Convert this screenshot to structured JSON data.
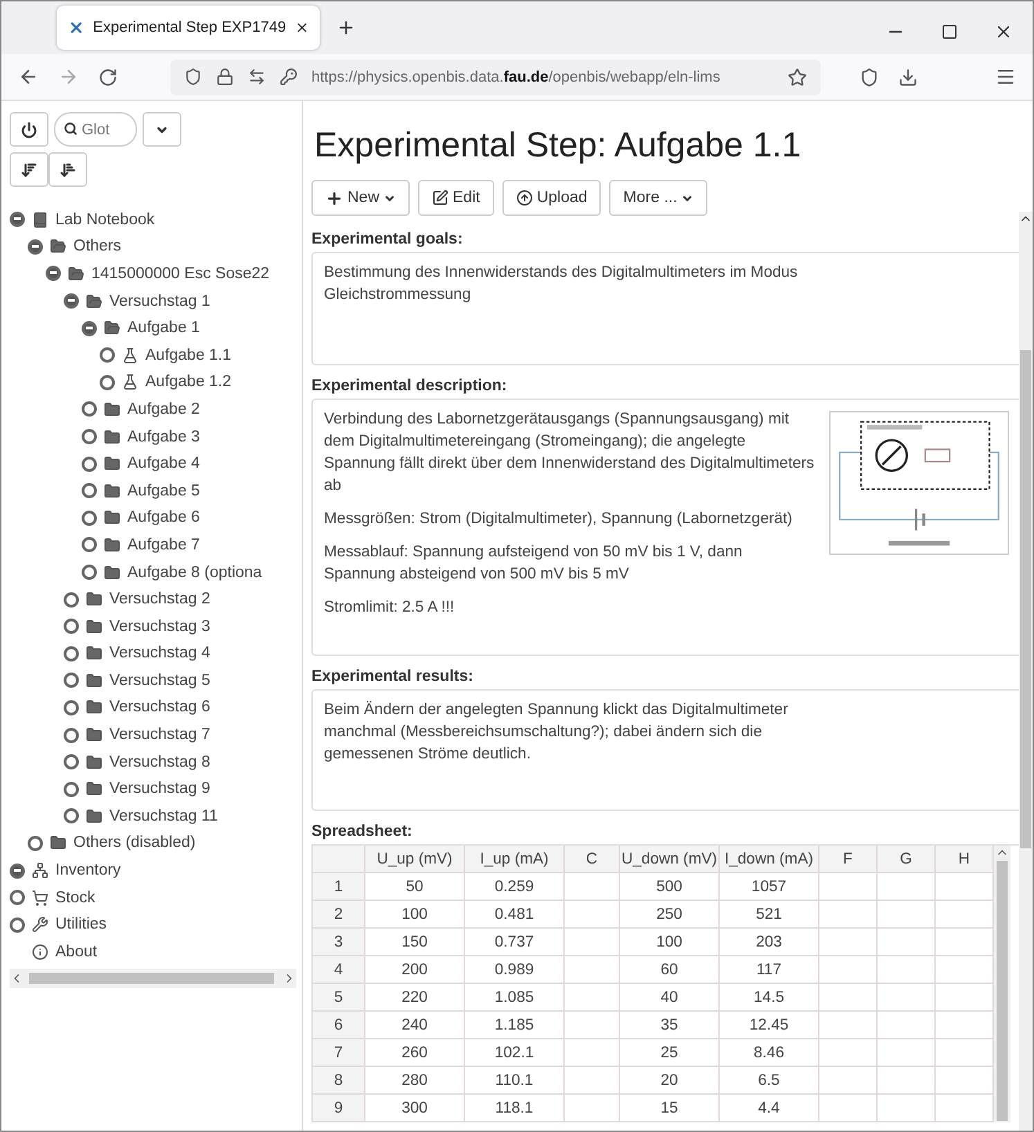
{
  "browser": {
    "tab_title": "Experimental Step EXP1749",
    "url": "https://physics.openbis.data.**fau.de**/openbis/webapp/eln-lims"
  },
  "sidebar": {
    "search_placeholder": "Glot",
    "tree": [
      {
        "label": "Lab Notebook",
        "kind": "notebook",
        "expanded": true,
        "children": [
          {
            "label": "Others",
            "kind": "folder",
            "expanded": true,
            "children": [
              {
                "label": "1415000000 Esc Sose22",
                "kind": "folder",
                "expanded": true,
                "children": [
                  {
                    "label": "Versuchstag 1",
                    "kind": "folder",
                    "expanded": true,
                    "children": [
                      {
                        "label": "Aufgabe 1",
                        "kind": "folder",
                        "expanded": true,
                        "children": [
                          {
                            "label": "Aufgabe 1.1",
                            "kind": "flask",
                            "expanded": false
                          },
                          {
                            "label": "Aufgabe 1.2",
                            "kind": "flask",
                            "expanded": false
                          }
                        ]
                      },
                      {
                        "label": "Aufgabe 2",
                        "kind": "box",
                        "expanded": false
                      },
                      {
                        "label": "Aufgabe 3",
                        "kind": "box",
                        "expanded": false
                      },
                      {
                        "label": "Aufgabe 4",
                        "kind": "box",
                        "expanded": false
                      },
                      {
                        "label": "Aufgabe 5",
                        "kind": "box",
                        "expanded": false
                      },
                      {
                        "label": "Aufgabe 6",
                        "kind": "box",
                        "expanded": false
                      },
                      {
                        "label": "Aufgabe 7",
                        "kind": "box",
                        "expanded": false
                      },
                      {
                        "label": "Aufgabe 8 (optiona",
                        "kind": "box",
                        "expanded": false
                      }
                    ]
                  },
                  {
                    "label": "Versuchstag 2",
                    "kind": "box",
                    "expanded": false
                  },
                  {
                    "label": "Versuchstag 3",
                    "kind": "box",
                    "expanded": false
                  },
                  {
                    "label": "Versuchstag 4",
                    "kind": "box",
                    "expanded": false
                  },
                  {
                    "label": "Versuchstag 5",
                    "kind": "box",
                    "expanded": false
                  },
                  {
                    "label": "Versuchstag 6",
                    "kind": "box",
                    "expanded": false
                  },
                  {
                    "label": "Versuchstag 7",
                    "kind": "box",
                    "expanded": false
                  },
                  {
                    "label": "Versuchstag 8",
                    "kind": "box",
                    "expanded": false
                  },
                  {
                    "label": "Versuchstag 9",
                    "kind": "box",
                    "expanded": false
                  },
                  {
                    "label": "Versuchstag 11",
                    "kind": "box",
                    "expanded": false
                  }
                ]
              }
            ]
          },
          {
            "label": "Others (disabled)",
            "kind": "box",
            "expanded": false
          }
        ]
      },
      {
        "label": "Inventory",
        "kind": "inventory",
        "expanded": true
      },
      {
        "label": "Stock",
        "kind": "stock",
        "expanded": false
      },
      {
        "label": "Utilities",
        "kind": "utilities",
        "expanded": false
      },
      {
        "label": "About",
        "kind": "about"
      }
    ]
  },
  "main": {
    "title": "Experimental Step: Aufgabe 1.1",
    "actions": [
      {
        "label": "New",
        "kind": "new",
        "dropdown": true
      },
      {
        "label": "Edit",
        "kind": "edit",
        "dropdown": false
      },
      {
        "label": "Upload",
        "kind": "upload",
        "dropdown": false
      },
      {
        "label": "More ...",
        "kind": "more",
        "dropdown": true
      }
    ],
    "goals": {
      "heading": "Experimental goals:",
      "paragraphs": [
        "Bestimmung des Innenwiderstands des Digitalmultimeters im Modus Gleichstrommessung"
      ]
    },
    "description": {
      "heading": "Experimental description:",
      "paragraphs": [
        "Verbindung des Labornetzgerätausgangs (Spannungsausgang) mit dem Digitalmultimetereingang (Stromeingang); die angelegte Spannung fällt direkt über dem Innenwiderstand des Digitalmultimeters ab",
        "Messgrößen: Strom (Digitalmultimeter), Spannung (Labornetzgerät)",
        "Messablauf: Spannung aufsteigend von 50 mV bis 1 V, dann Spannung absteigend von 500 mV bis 5 mV",
        "Stromlimit: 2.5 A !!!"
      ]
    },
    "results": {
      "heading": "Experimental results:",
      "paragraphs": [
        "Beim Ändern der angelegten Spannung klickt das Digitalmultimeter manchmal (Messbereichsumschaltung?); dabei ändern sich die gemessenen Ströme deutlich."
      ]
    },
    "spreadsheet": {
      "heading": "Spreadsheet:",
      "columns": [
        "U_up (mV)",
        "I_up (mA)",
        "C",
        "U_down (mV)",
        "I_down (mA)",
        "F",
        "G",
        "H"
      ],
      "rows": [
        {
          "index": "1",
          "cells": [
            "50",
            "0.259",
            "",
            "500",
            "1057",
            "",
            "",
            ""
          ]
        },
        {
          "index": "2",
          "cells": [
            "100",
            "0.481",
            "",
            "250",
            "521",
            "",
            "",
            ""
          ]
        },
        {
          "index": "3",
          "cells": [
            "150",
            "0.737",
            "",
            "100",
            "203",
            "",
            "",
            ""
          ]
        },
        {
          "index": "4",
          "cells": [
            "200",
            "0.989",
            "",
            "60",
            "117",
            "",
            "",
            ""
          ]
        },
        {
          "index": "5",
          "cells": [
            "220",
            "1.085",
            "",
            "40",
            "14.5",
            "",
            "",
            ""
          ]
        },
        {
          "index": "6",
          "cells": [
            "240",
            "1.185",
            "",
            "35",
            "12.45",
            "",
            "",
            ""
          ]
        },
        {
          "index": "7",
          "cells": [
            "260",
            "102.1",
            "",
            "25",
            "8.46",
            "",
            "",
            ""
          ]
        },
        {
          "index": "8",
          "cells": [
            "280",
            "110.1",
            "",
            "20",
            "6.5",
            "",
            "",
            ""
          ]
        },
        {
          "index": "9",
          "cells": [
            "300",
            "118.1",
            "",
            "15",
            "4.4",
            "",
            "",
            ""
          ]
        }
      ]
    }
  }
}
